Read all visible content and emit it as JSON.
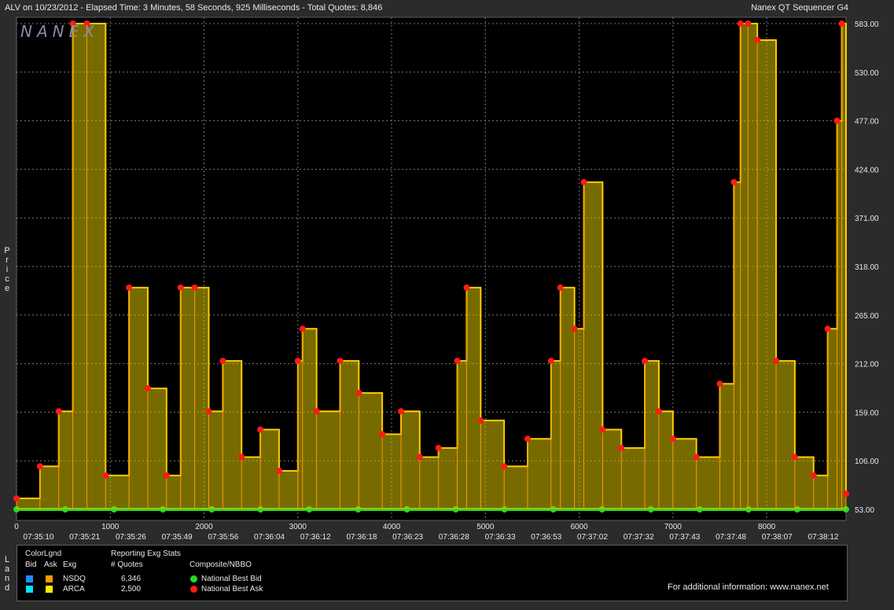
{
  "header": {
    "title": "ALV on 10/23/2012  -  Elapsed Time: 3 Minutes, 58 Seconds, 925 Milliseconds  -  Total Quotes: 8,846",
    "app_name": "Nanex QT Sequencer G4",
    "watermark": "NANEX"
  },
  "side_labels": {
    "price": "Price",
    "land": "Land"
  },
  "legend": {
    "colorlgnd": "ColorLgnd",
    "bid": "Bid",
    "ask": "Ask",
    "exg": "Exg",
    "reporting": "Reporting Exg Stats",
    "quotes_header": "# Quotes",
    "composite": "Composite/NBBO",
    "exchanges": [
      {
        "name": "NSDQ",
        "quotes": "6,346",
        "bid_color": "#1e8fff",
        "ask_color": "#ff9900"
      },
      {
        "name": "ARCA",
        "quotes": "2,500",
        "bid_color": "#00e5ff",
        "ask_color": "#ffee00"
      }
    ],
    "nbbo": [
      {
        "label": "National Best Bid",
        "color": "#22dd22"
      },
      {
        "label": "National Best Ask",
        "color": "#ff1a1a"
      }
    ],
    "footer": "For additional information: www.nanex.net"
  },
  "chart_data": {
    "type": "line",
    "y_ticks": [
      "53.00",
      "106.00",
      "159.00",
      "212.00",
      "265.00",
      "318.00",
      "371.00",
      "424.00",
      "477.00",
      "530.00",
      "583.00"
    ],
    "ylim": [
      53,
      583
    ],
    "x_ticks": [
      "0",
      "1000",
      "2000",
      "3000",
      "4000",
      "5000",
      "6000",
      "7000",
      "8000"
    ],
    "xlim": [
      0,
      8846
    ],
    "time_ticks": [
      "07:35:10",
      "07:35:21",
      "07:35:26",
      "07:35:49",
      "07:35:56",
      "07:36:04",
      "07:36:12",
      "07:36:18",
      "07:36:23",
      "07:36:28",
      "07:36:33",
      "07:36:53",
      "07:37:02",
      "07:37:32",
      "07:37:43",
      "07:37:48",
      "07:38:07",
      "07:38:12"
    ],
    "grid": true,
    "series": [
      {
        "name": "National Best Bid",
        "values": [
          53,
          53,
          53,
          53,
          53,
          53,
          53,
          53,
          53,
          53,
          53,
          53,
          53,
          53,
          53,
          53,
          53,
          53
        ]
      },
      {
        "name": "National Best Ask",
        "x": [
          0,
          250,
          450,
          600,
          750,
          950,
          1200,
          1400,
          1600,
          1750,
          1900,
          2050,
          2200,
          2400,
          2600,
          2800,
          3000,
          3050,
          3200,
          3450,
          3650,
          3900,
          4100,
          4300,
          4500,
          4700,
          4800,
          4950,
          5200,
          5450,
          5700,
          5800,
          5950,
          6050,
          6250,
          6450,
          6700,
          6850,
          7000,
          7250,
          7500,
          7650,
          7720,
          7800,
          7900,
          8100,
          8300,
          8500,
          8650,
          8750,
          8800,
          8846
        ],
        "values": [
          65,
          100,
          160,
          583,
          583,
          90,
          295,
          185,
          90,
          295,
          295,
          160,
          215,
          110,
          140,
          95,
          215,
          250,
          160,
          215,
          180,
          135,
          160,
          110,
          120,
          215,
          295,
          150,
          100,
          130,
          215,
          295,
          250,
          410,
          140,
          120,
          215,
          160,
          130,
          110,
          190,
          410,
          583,
          583,
          565,
          215,
          110,
          90,
          250,
          477,
          583,
          70
        ]
      }
    ]
  }
}
